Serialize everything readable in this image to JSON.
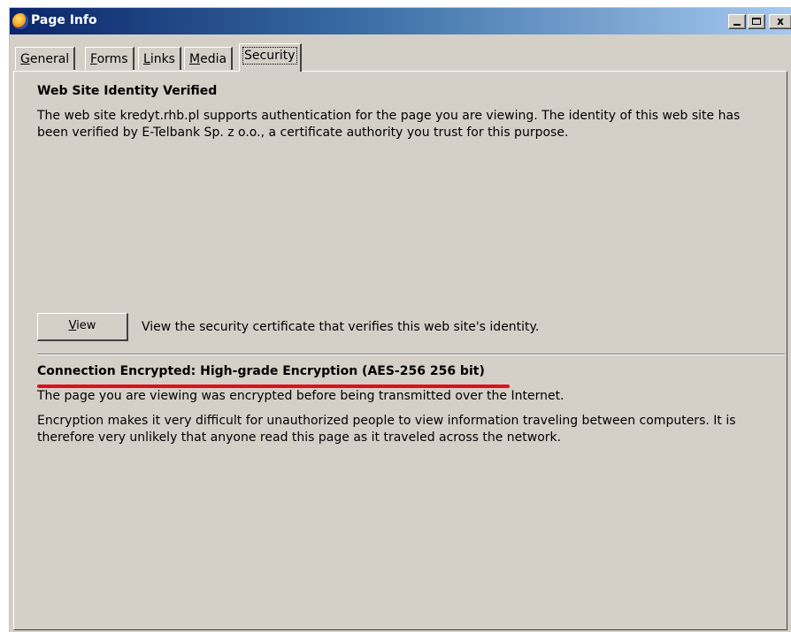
{
  "window": {
    "title": "Page Info",
    "controls": {
      "minimize": "_",
      "maximize": "□",
      "close": "x"
    }
  },
  "tabs": [
    {
      "label": "General",
      "accesskey": "G"
    },
    {
      "label": "Forms",
      "accesskey": "F"
    },
    {
      "label": "Links",
      "accesskey": "L"
    },
    {
      "label": "Media",
      "accesskey": "M"
    },
    {
      "label": "Security",
      "accesskey": "",
      "active": true
    }
  ],
  "identity": {
    "heading": "Web Site Identity Verified",
    "text": "The web site kredyt.rhb.pl supports authentication for the page you are viewing. The identity of this web site has been verified by E-Telbank Sp. z o.o., a certificate authority you trust for this purpose.",
    "view_button": "View",
    "view_description": "View the security certificate that verifies this web site's identity."
  },
  "encryption": {
    "heading": "Connection Encrypted: High-grade Encryption (AES-256 256 bit)",
    "text1": "The page you are viewing was encrypted before being transmitted over the Internet.",
    "text2": "Encryption makes it very difficult for unauthorized people to view information traveling between computers. It is therefore very unlikely that anyone read this page as it traveled across the network."
  },
  "colors": {
    "titlebar_start": "#0a246a",
    "titlebar_end": "#a6caf0",
    "dialog_bg": "#d4d0c8",
    "annotation_red": "#e0101a"
  }
}
